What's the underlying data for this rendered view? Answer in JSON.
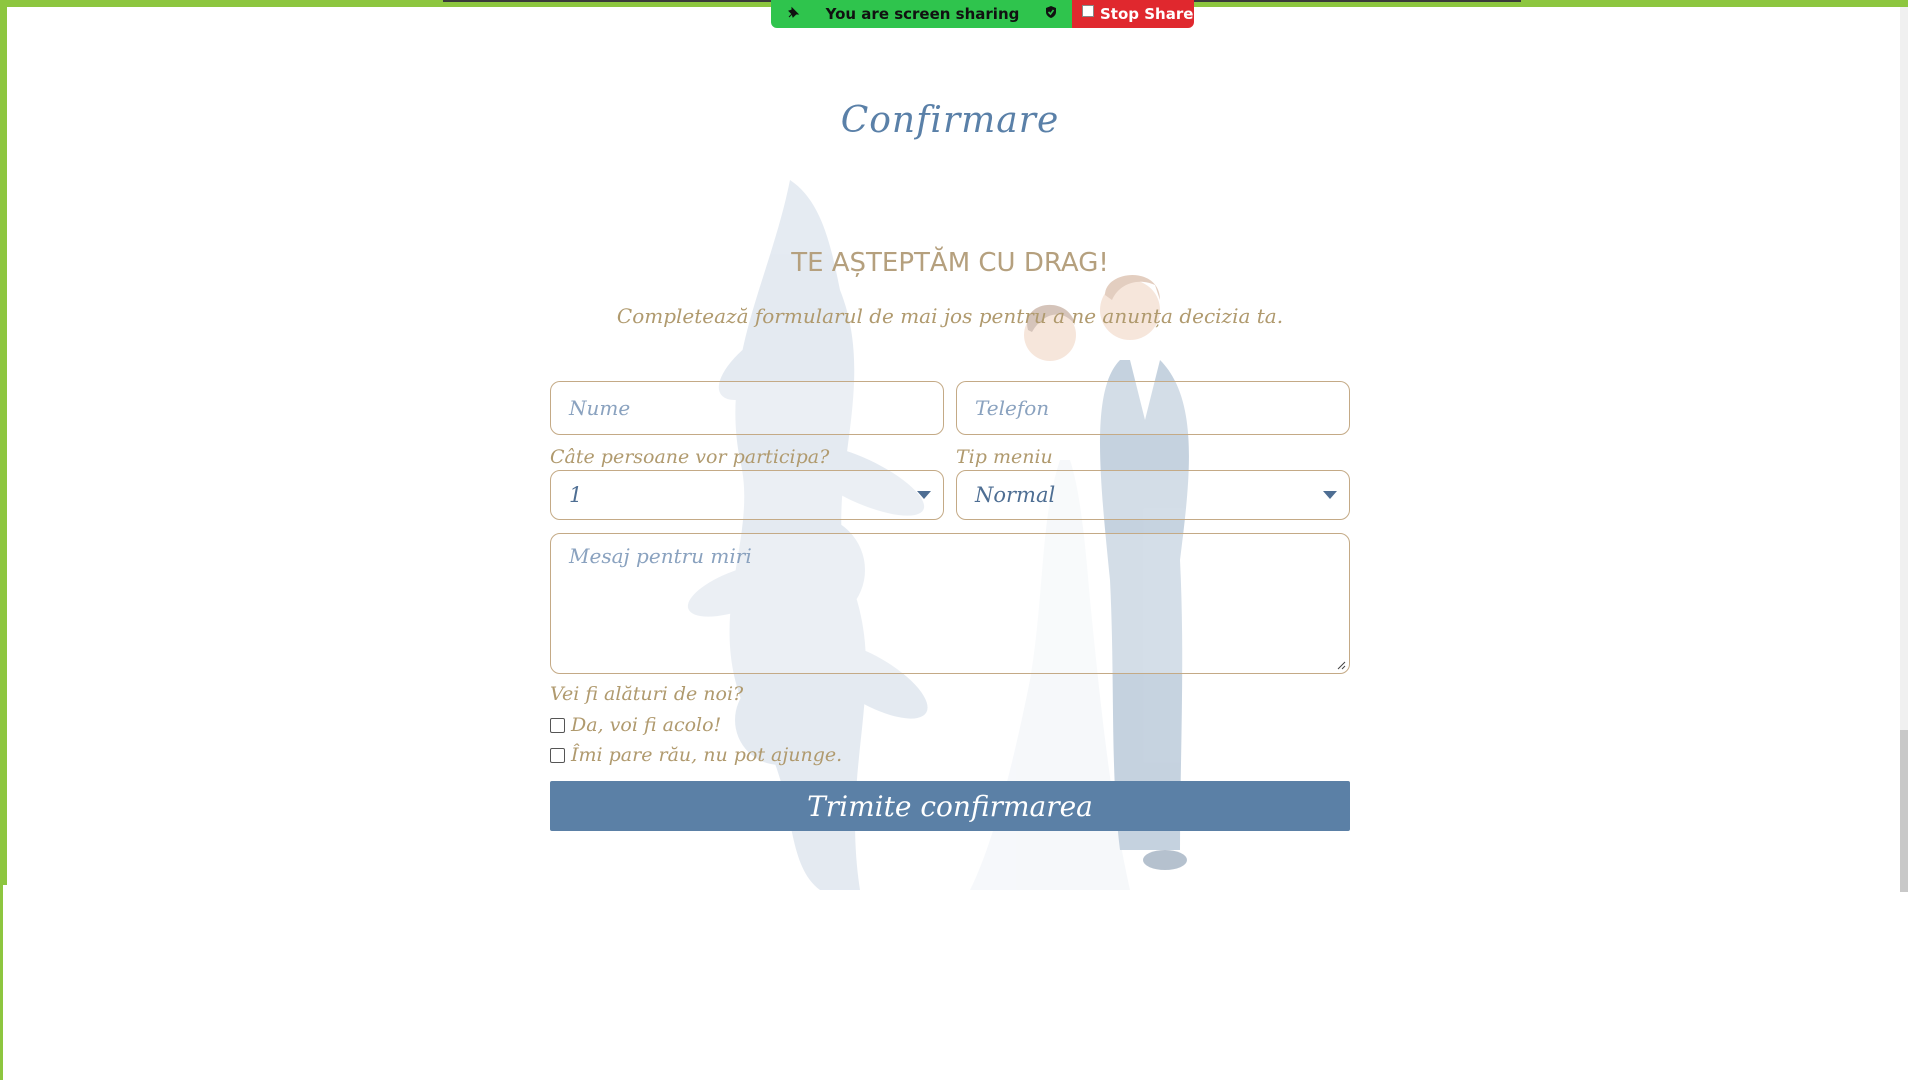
{
  "share_bar": {
    "status_text": "You are screen sharing",
    "stop_label": "Stop Share",
    "green_color": "#2fc44d",
    "red_color": "#e0282e"
  },
  "page": {
    "title": "Confirmare",
    "heading": "TE AȘTEPTĂM CU DRAG!",
    "subheading": "Completează formularul de mai jos pentru a ne anunța decizia ta."
  },
  "form": {
    "name_placeholder": "Nume",
    "phone_placeholder": "Telefon",
    "guests_label": "Câte persoane vor participa?",
    "guests_value": "1",
    "menu_label": "Tip meniu",
    "menu_value": "Normal",
    "message_placeholder": "Mesaj pentru miri",
    "attend_question": "Vei fi alături de noi?",
    "option_yes": "Da, voi fi acolo!",
    "option_no": "Îmi pare rău, nu pot ajunge.",
    "submit_label": "Trimite confirmarea"
  },
  "colors": {
    "frame": "#8dc63f",
    "accent_blue": "#5b80a6",
    "gold": "#b09a6e"
  }
}
